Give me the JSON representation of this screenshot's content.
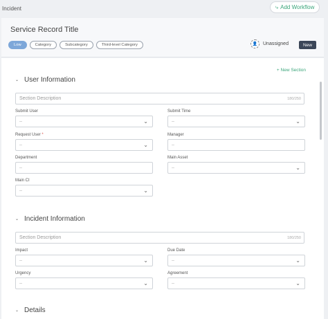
{
  "topbar": {
    "title": "Incident",
    "add_workflow": "Add Workflow"
  },
  "header": {
    "record_title": "Service Record Title",
    "tags": [
      "Low",
      "Category",
      "Subcategory",
      "Third-level Category"
    ],
    "assignee": "Unassigned",
    "status": "New"
  },
  "body": {
    "new_section": "+ New Section",
    "sections": [
      {
        "title": "User Information",
        "description_placeholder": "Section Description",
        "counter": "180/250",
        "fields": [
          {
            "label": "Submit User",
            "value": "--",
            "required": ""
          },
          {
            "label": "Submit Time",
            "value": "--",
            "required": ""
          },
          {
            "label": "Request User",
            "value": "--",
            "required": "*"
          },
          {
            "label": "Manager",
            "value": "--",
            "required": ""
          },
          {
            "label": "Department",
            "value": "--",
            "required": ""
          },
          {
            "label": "Main Asset",
            "value": "--",
            "required": ""
          },
          {
            "label": "Main CI",
            "value": "--",
            "required": ""
          }
        ]
      },
      {
        "title": "Incident Information",
        "description_placeholder": "Section Description",
        "counter": "180/250",
        "fields": [
          {
            "label": "Impact",
            "value": "--",
            "required": ""
          },
          {
            "label": "Due Date",
            "value": "--",
            "required": ""
          },
          {
            "label": "Urgency",
            "value": "--",
            "required": ""
          },
          {
            "label": "Agreement",
            "value": "--",
            "required": ""
          }
        ]
      },
      {
        "title": "Details"
      }
    ]
  },
  "colors": {
    "accent_green": "#3aa57a",
    "tag_low": "#7da7d9",
    "status_button": "#3b4658"
  }
}
